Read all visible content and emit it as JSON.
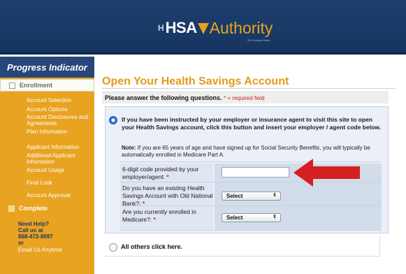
{
  "header": {
    "logo_prefix": "H",
    "logo_hsa": "HSA",
    "logo_authority": "Authority",
    "logo_sub": "Old National Bank"
  },
  "sidebar": {
    "title": "Progress Indicator",
    "enrollment": "Enrollment",
    "items": [
      "Account Selection",
      "Account Options",
      "Account Disclosures and Agreements",
      "Plan Information",
      "Applicant Information",
      "Additional Applicant Information",
      "Account Usage",
      "Final Look",
      "Account Approval"
    ],
    "complete": "Complete",
    "help": {
      "need_help": "Need Help?",
      "call_us": "Call us at",
      "phone": "888-472-8697",
      "or": "or",
      "email": "Email Us Anytime"
    }
  },
  "main": {
    "title": "Open Your Health Savings Account",
    "question_header": "Please answer the following questions.",
    "required_note": "* = required field",
    "instruction": "If you have been instructed by your employer or insurance agent to visit this site to open your Health Savings account, click this button and insert your employer / agent code below.",
    "note_label": "Note:",
    "note_text": "If you are 65 years of age and have signed up for Social Security Benefits, you will typically be automatically enrolled in Medicare Part A.",
    "fields": {
      "code_label": "6-digit code provided by your employer/agent:",
      "code_value": "",
      "existing_label": "Do you have an existing Health Savings Account with Old National Bank?:",
      "existing_value": "Select",
      "medicare_label": "Are you currently enrolled in Medicare?:",
      "medicare_value": "Select"
    },
    "required_star": "*",
    "others": "All others click here."
  },
  "colors": {
    "header_bg": "#1d3f6e",
    "sidebar_bg": "#e8a320",
    "title_orange": "#e19a1d",
    "arrow_red": "#d42020"
  }
}
